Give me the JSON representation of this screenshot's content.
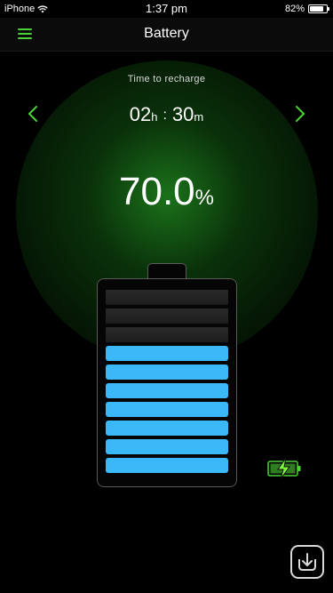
{
  "status_bar": {
    "carrier": "iPhone",
    "time": "1:37 pm",
    "battery_percent": "82%",
    "battery_level": 0.82
  },
  "nav": {
    "title": "Battery",
    "menu_icon": "hamburger-menu-icon"
  },
  "recharge": {
    "label": "Time to recharge",
    "hours": "02",
    "hours_unit": "h",
    "separator": ":",
    "minutes": "30",
    "minutes_unit": "m",
    "prev_icon": "chevron-left-icon",
    "next_icon": "chevron-right-icon"
  },
  "charge": {
    "value": "70.0",
    "unit": "%",
    "level": 0.7,
    "cells_total": 10,
    "cells_filled": 7
  },
  "colors": {
    "accent_green": "#4cd137",
    "cell_blue": "#3ab8f7",
    "glow_green": "#1c781c"
  },
  "icons": {
    "charging": "battery-charging-icon",
    "corner": "app-badge-icon"
  }
}
